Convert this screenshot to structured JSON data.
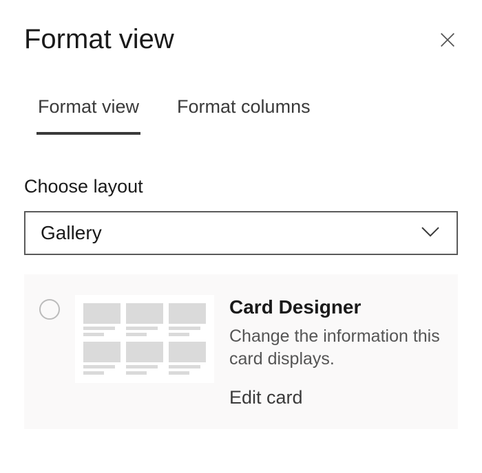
{
  "header": {
    "title": "Format view"
  },
  "tabs": {
    "format_view": "Format view",
    "format_columns": "Format columns"
  },
  "layout": {
    "label": "Choose layout",
    "selected": "Gallery"
  },
  "card": {
    "title": "Card Designer",
    "description": "Change the information this card displays.",
    "link": "Edit card"
  }
}
